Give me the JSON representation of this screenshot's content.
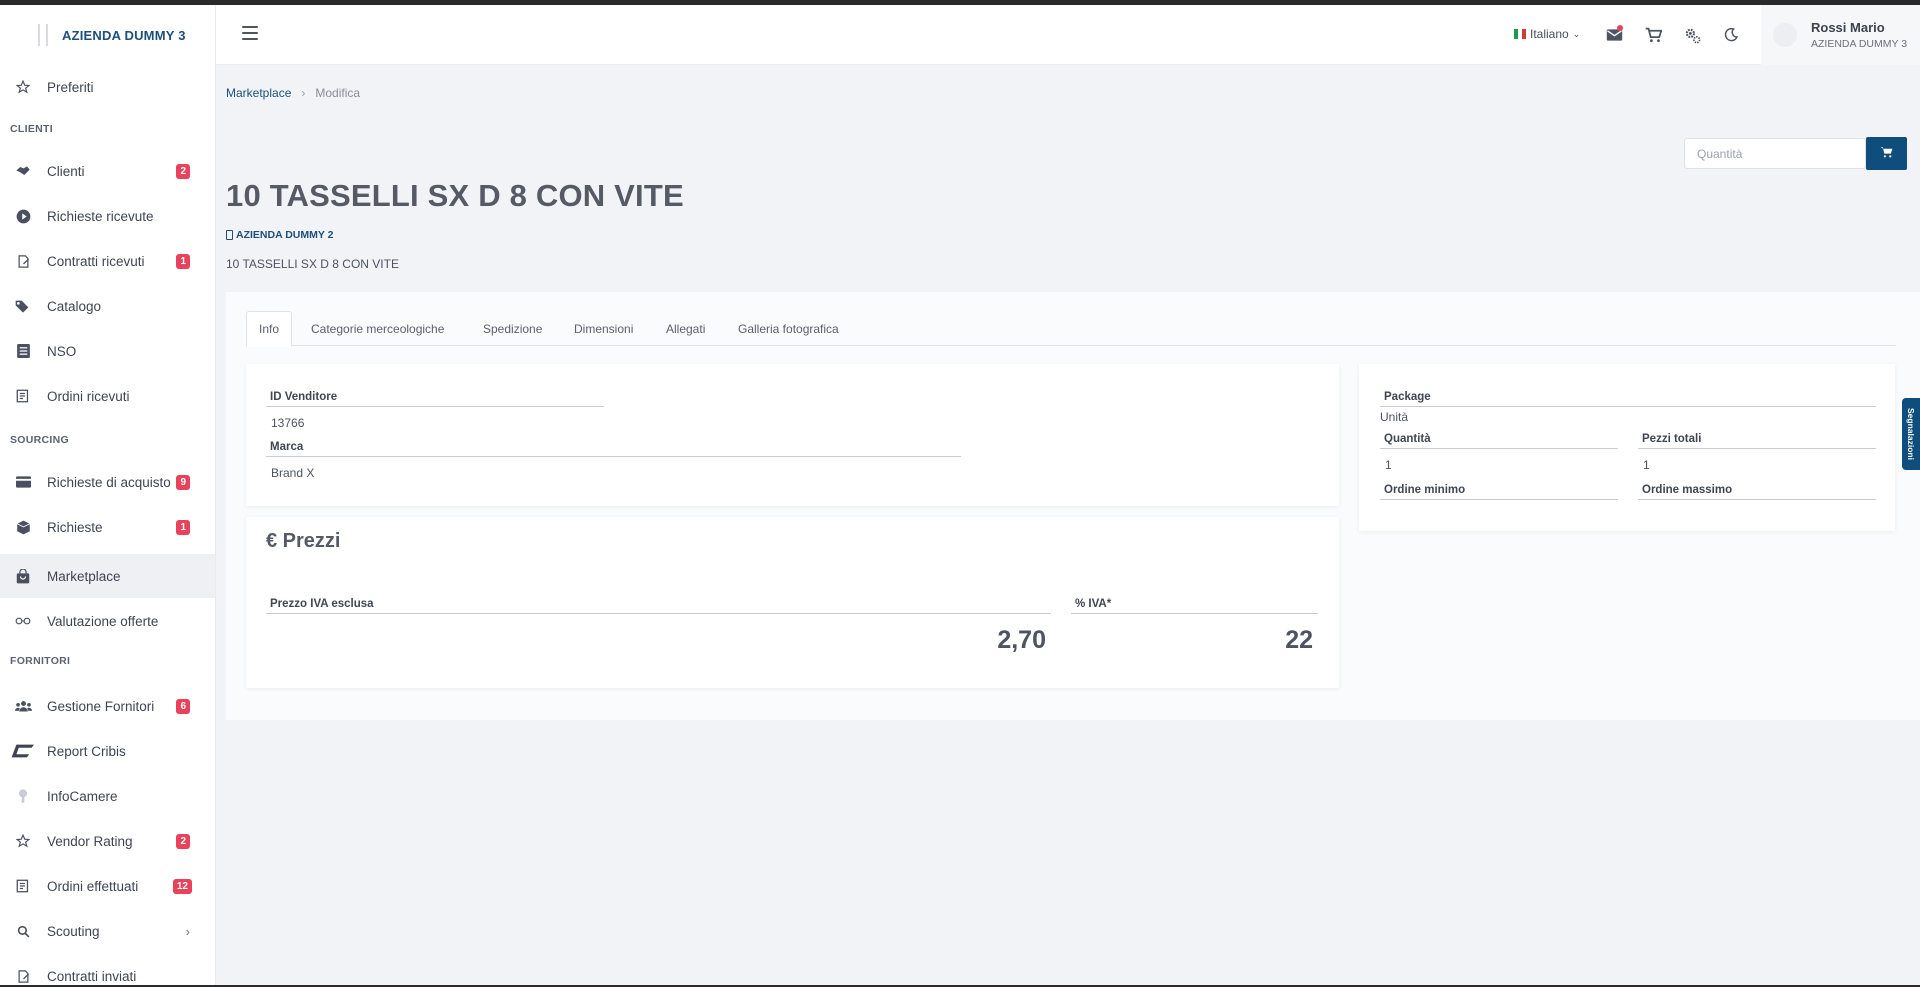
{
  "brand": {
    "name": "AZIENDA DUMMY 3"
  },
  "sidebar": {
    "favorites": "Preferiti",
    "sections": {
      "clienti": "CLIENTI",
      "sourcing": "SOURCING",
      "fornitori": "FORNITORI"
    },
    "items": [
      {
        "label": "Clienti",
        "badge": "2",
        "icon": "handshake-icon"
      },
      {
        "label": "Richieste ricevute",
        "icon": "play-circle-icon"
      },
      {
        "label": "Contratti ricevuti",
        "badge": "1",
        "icon": "contract-icon"
      },
      {
        "label": "Catalogo",
        "icon": "tags-icon"
      },
      {
        "label": "NSO",
        "icon": "list-icon"
      },
      {
        "label": "Ordini ricevuti",
        "icon": "receipt-icon"
      },
      {
        "label": "Richieste di acquisto",
        "badge": "9",
        "icon": "card-icon"
      },
      {
        "label": "Richieste",
        "badge": "1",
        "icon": "box-icon"
      },
      {
        "label": "Marketplace",
        "icon": "shopping-bag-icon"
      },
      {
        "label": "Valutazione offerte",
        "icon": "glasses-icon"
      },
      {
        "label": "Gestione Fornitori",
        "badge": "6",
        "icon": "users-icon"
      },
      {
        "label": "Report Cribis",
        "icon": "cribis-logo-icon"
      },
      {
        "label": "InfoCamere",
        "icon": "infocamere-icon"
      },
      {
        "label": "Vendor Rating",
        "badge": "2",
        "icon": "star-icon"
      },
      {
        "label": "Ordini effettuati",
        "badge": "12",
        "icon": "receipt-icon"
      },
      {
        "label": "Scouting",
        "icon": "search-icon"
      },
      {
        "label": "Contratti inviati",
        "icon": "contract-icon"
      }
    ]
  },
  "header": {
    "language": "Italiano",
    "user": {
      "name": "Rossi Mario",
      "company": "AZIENDA DUMMY 3"
    }
  },
  "breadcrumb": {
    "root": "Marketplace",
    "current": "Modifica"
  },
  "cart": {
    "quantity_placeholder": "Quantità"
  },
  "product": {
    "title": "10 TASSELLI SX D 8 CON VITE",
    "vendor": "AZIENDA DUMMY 2",
    "description": "10 TASSELLI SX D 8 CON VITE"
  },
  "tabs": [
    "Info",
    "Categorie merceologiche",
    "Spedizione",
    "Dimensioni",
    "Allegati",
    "Galleria fotografica"
  ],
  "info": {
    "vendor_id_label": "ID Venditore",
    "vendor_id": "13766",
    "brand_label": "Marca",
    "brand": "Brand X"
  },
  "package": {
    "package_label": "Package",
    "package_value": "Unità",
    "quantity_label": "Quantità",
    "quantity_value": "1",
    "total_pieces_label": "Pezzi totali",
    "total_pieces_value": "1",
    "min_order_label": "Ordine minimo",
    "max_order_label": "Ordine massimo"
  },
  "prices": {
    "title": "€ Prezzi",
    "price_label": "Prezzo IVA esclusa",
    "price_value": "2,70",
    "vat_label": "% IVA*",
    "vat_value": "22"
  },
  "side_tab": "Segnalazioni",
  "colors": {
    "brand": "#1d4f7c",
    "primary_button": "#0e4d7c",
    "badge": "#e8435a"
  }
}
